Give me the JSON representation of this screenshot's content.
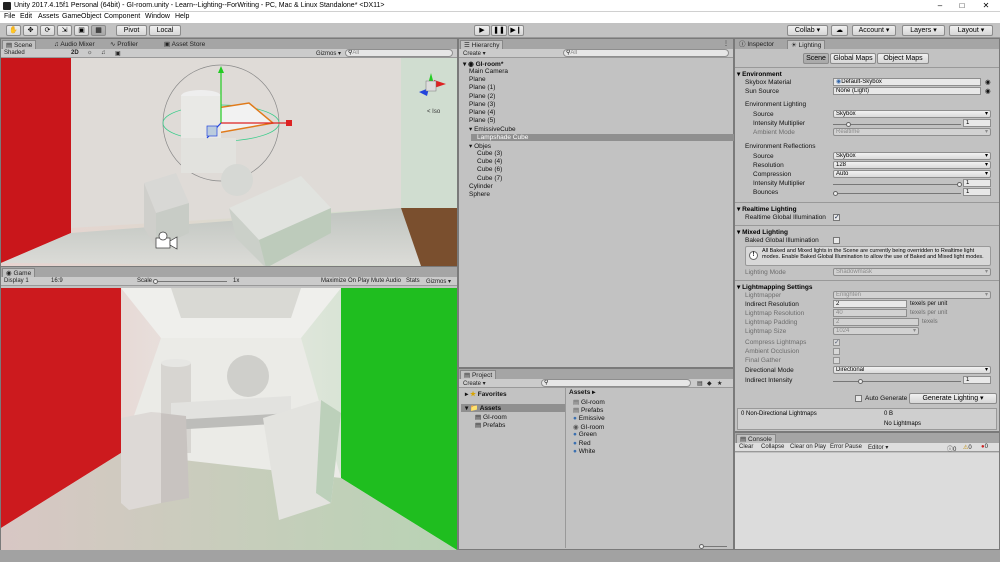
{
  "window": {
    "title": "Unity 2017.4.15f1 Personal (64bit) - GI-room.unity - Learn--Lighting--ForWriting - PC, Mac & Linux Standalone* <DX11>"
  },
  "menu": [
    "File",
    "Edit",
    "Assets",
    "GameObject",
    "Component",
    "Window",
    "Help"
  ],
  "toolbar": {
    "pivot": "Pivot",
    "local": "Local",
    "collab": "Collab ▾",
    "account": "Account",
    "layers": "Layers",
    "layout": "Layout"
  },
  "scene": {
    "tabs": [
      "Scene",
      "Audio Mixer",
      "Profiler",
      "Asset Store"
    ],
    "shading": "Shaded",
    "mode2d": "2D",
    "gizmos": "Gizmos ▾",
    "search_placeholder": "All",
    "persp": "< Iso"
  },
  "game": {
    "tab": "Game",
    "display": "Display 1",
    "aspect": "16:9",
    "scale_label": "Scale",
    "scale_value": "1x",
    "buttons": [
      "Maximize On Play",
      "Mute Audio",
      "Stats",
      "Gizmos ▾"
    ]
  },
  "hierarchy": {
    "tab": "Hierarchy",
    "create": "Create ▾",
    "search_placeholder": "All",
    "scene": "GI-room*",
    "items": [
      {
        "label": "Main Camera",
        "indent": 1
      },
      {
        "label": "Plane",
        "indent": 1
      },
      {
        "label": "Plane (1)",
        "indent": 1
      },
      {
        "label": "Plane (2)",
        "indent": 1
      },
      {
        "label": "Plane (3)",
        "indent": 1
      },
      {
        "label": "Plane (4)",
        "indent": 1
      },
      {
        "label": "Plane (5)",
        "indent": 1
      },
      {
        "label": "EmissiveCube",
        "indent": 1,
        "fold": true
      },
      {
        "label": "Lampshade Cube",
        "indent": 2,
        "selected": true
      },
      {
        "label": "Objes",
        "indent": 1,
        "fold": true
      },
      {
        "label": "Cube (3)",
        "indent": 2
      },
      {
        "label": "Cube (4)",
        "indent": 2
      },
      {
        "label": "Cube (6)",
        "indent": 2
      },
      {
        "label": "Cube (7)",
        "indent": 2
      },
      {
        "label": "Cylinder",
        "indent": 1
      },
      {
        "label": "Sphere",
        "indent": 1
      }
    ]
  },
  "project": {
    "tab": "Project",
    "create": "Create ▾",
    "favorites": "Favorites",
    "assets_tree": "Assets",
    "tree_children": [
      "GI-room",
      "Prefabs"
    ],
    "breadcrumb": "Assets ▸",
    "assets": [
      "GI-room",
      "Prefabs",
      "Emissive",
      "GI-room",
      "Green",
      "Red",
      "White"
    ]
  },
  "inspector": {
    "tabs": [
      "Inspector",
      "Lighting"
    ],
    "subtabs": [
      "Scene",
      "Global Maps",
      "Object Maps"
    ],
    "environment": {
      "header": "Environment",
      "skybox_label": "Skybox Material",
      "skybox_value": "Default-Skybox",
      "sun_label": "Sun Source",
      "sun_value": "None (Light)",
      "env_lighting": "Environment Lighting",
      "source_label": "Source",
      "source_value": "Skybox",
      "intensity_label": "Intensity Multiplier",
      "intensity_value": "1",
      "ao_label": "Ambient Mode",
      "ao_value": "Realtime",
      "env_refl": "Environment Reflections",
      "rsource_label": "Source",
      "rsource_value": "Skybox",
      "res_label": "Resolution",
      "res_value": "128",
      "comp_label": "Compression",
      "comp_value": "Auto",
      "rint_label": "Intensity Multiplier",
      "rint_value": "1",
      "bounces_label": "Bounces",
      "bounces_value": "1"
    },
    "realtime": {
      "header": "Realtime Lighting",
      "rgi_label": "Realtime Global Illumination"
    },
    "mixed": {
      "header": "Mixed Lighting",
      "bgi_label": "Baked Global Illumination",
      "info": "All Baked and Mixed lights in the Scene are currently being overridden to Realtime light modes. Enable Baked Global Illumination to allow the use of Baked and Mixed light modes.",
      "mode_label": "Lighting Mode",
      "mode_value": "Shadowmask"
    },
    "lightmap": {
      "header": "Lightmapping Settings",
      "lightmapper_label": "Lightmapper",
      "lightmapper_value": "Enlighten",
      "ir_label": "Indirect Resolution",
      "ir_value": "2",
      "ir_unit": "texels per unit",
      "lr_label": "Lightmap Resolution",
      "lr_value": "40",
      "lr_unit": "texels per unit",
      "lp_label": "Lightmap Padding",
      "lp_value": "2",
      "lp_unit": "texels",
      "ls_label": "Lightmap Size",
      "ls_value": "1024",
      "cl_label": "Compress Lightmaps",
      "ao_label": "Ambient Occlusion",
      "fg_label": "Final Gather",
      "dm_label": "Directional Mode",
      "dm_value": "Directional",
      "ii_label": "Indirect Intensity",
      "ii_value": "1"
    },
    "auto_generate": "Auto Generate",
    "generate": "Generate Lighting",
    "non_dir": "0 Non-Directional Lightmaps",
    "size": "0 B",
    "no_lightmaps": "No Lightmaps"
  },
  "console": {
    "tab": "Console",
    "buttons": [
      "Clear",
      "Collapse",
      "Clear on Play",
      "Error Pause",
      "Editor ▾"
    ],
    "counts": [
      "0",
      "0",
      "0"
    ]
  }
}
